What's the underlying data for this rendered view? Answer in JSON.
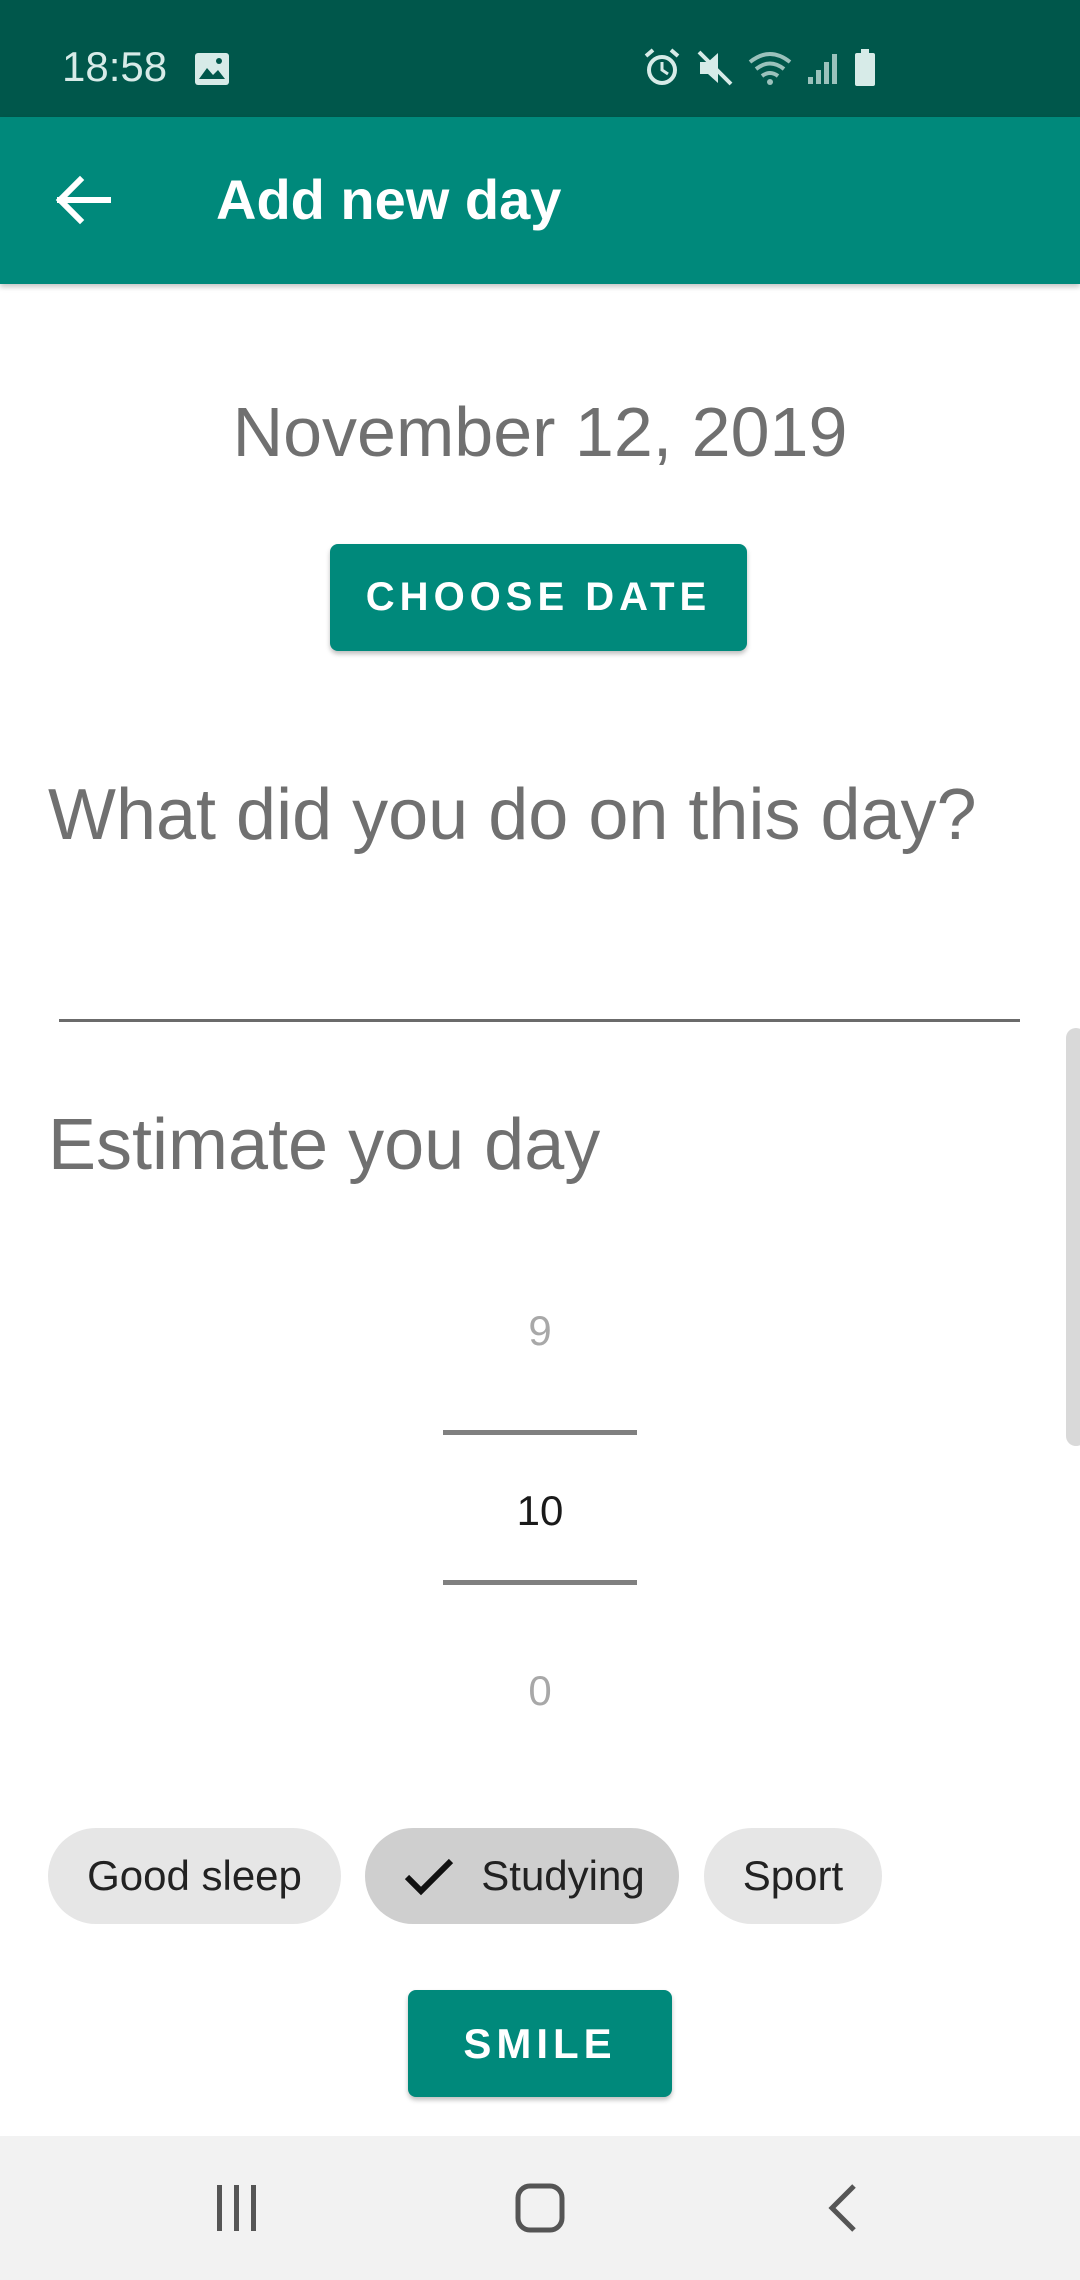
{
  "status_bar": {
    "time": "18:58",
    "icons": [
      "image-icon",
      "alarm-icon",
      "mute-icon",
      "wifi-icon",
      "signal-icon",
      "battery-icon"
    ]
  },
  "app_bar": {
    "title": "Add new day",
    "back_icon": "arrow-back-icon"
  },
  "date_section": {
    "date": "November 12, 2019",
    "choose_label": "CHOOSE DATE"
  },
  "activity": {
    "question": "What did you do on this day?",
    "value": ""
  },
  "estimate": {
    "title": "Estimate you day",
    "picker": {
      "above": "9",
      "current": "10",
      "below": "0"
    }
  },
  "chips": [
    {
      "label": "Good sleep",
      "selected": false
    },
    {
      "label": "Studying",
      "selected": true
    },
    {
      "label": "Sport",
      "selected": false
    }
  ],
  "submit_label": "SMILE",
  "nav_bar": {
    "icons": [
      "recent-apps-icon",
      "home-icon",
      "back-icon"
    ]
  },
  "colors": {
    "primary": "#00897b",
    "primary_dark": "#00574b",
    "text_secondary": "#707070",
    "chip_bg": "#e6e6e6",
    "chip_selected_bg": "#cfcfcf"
  }
}
